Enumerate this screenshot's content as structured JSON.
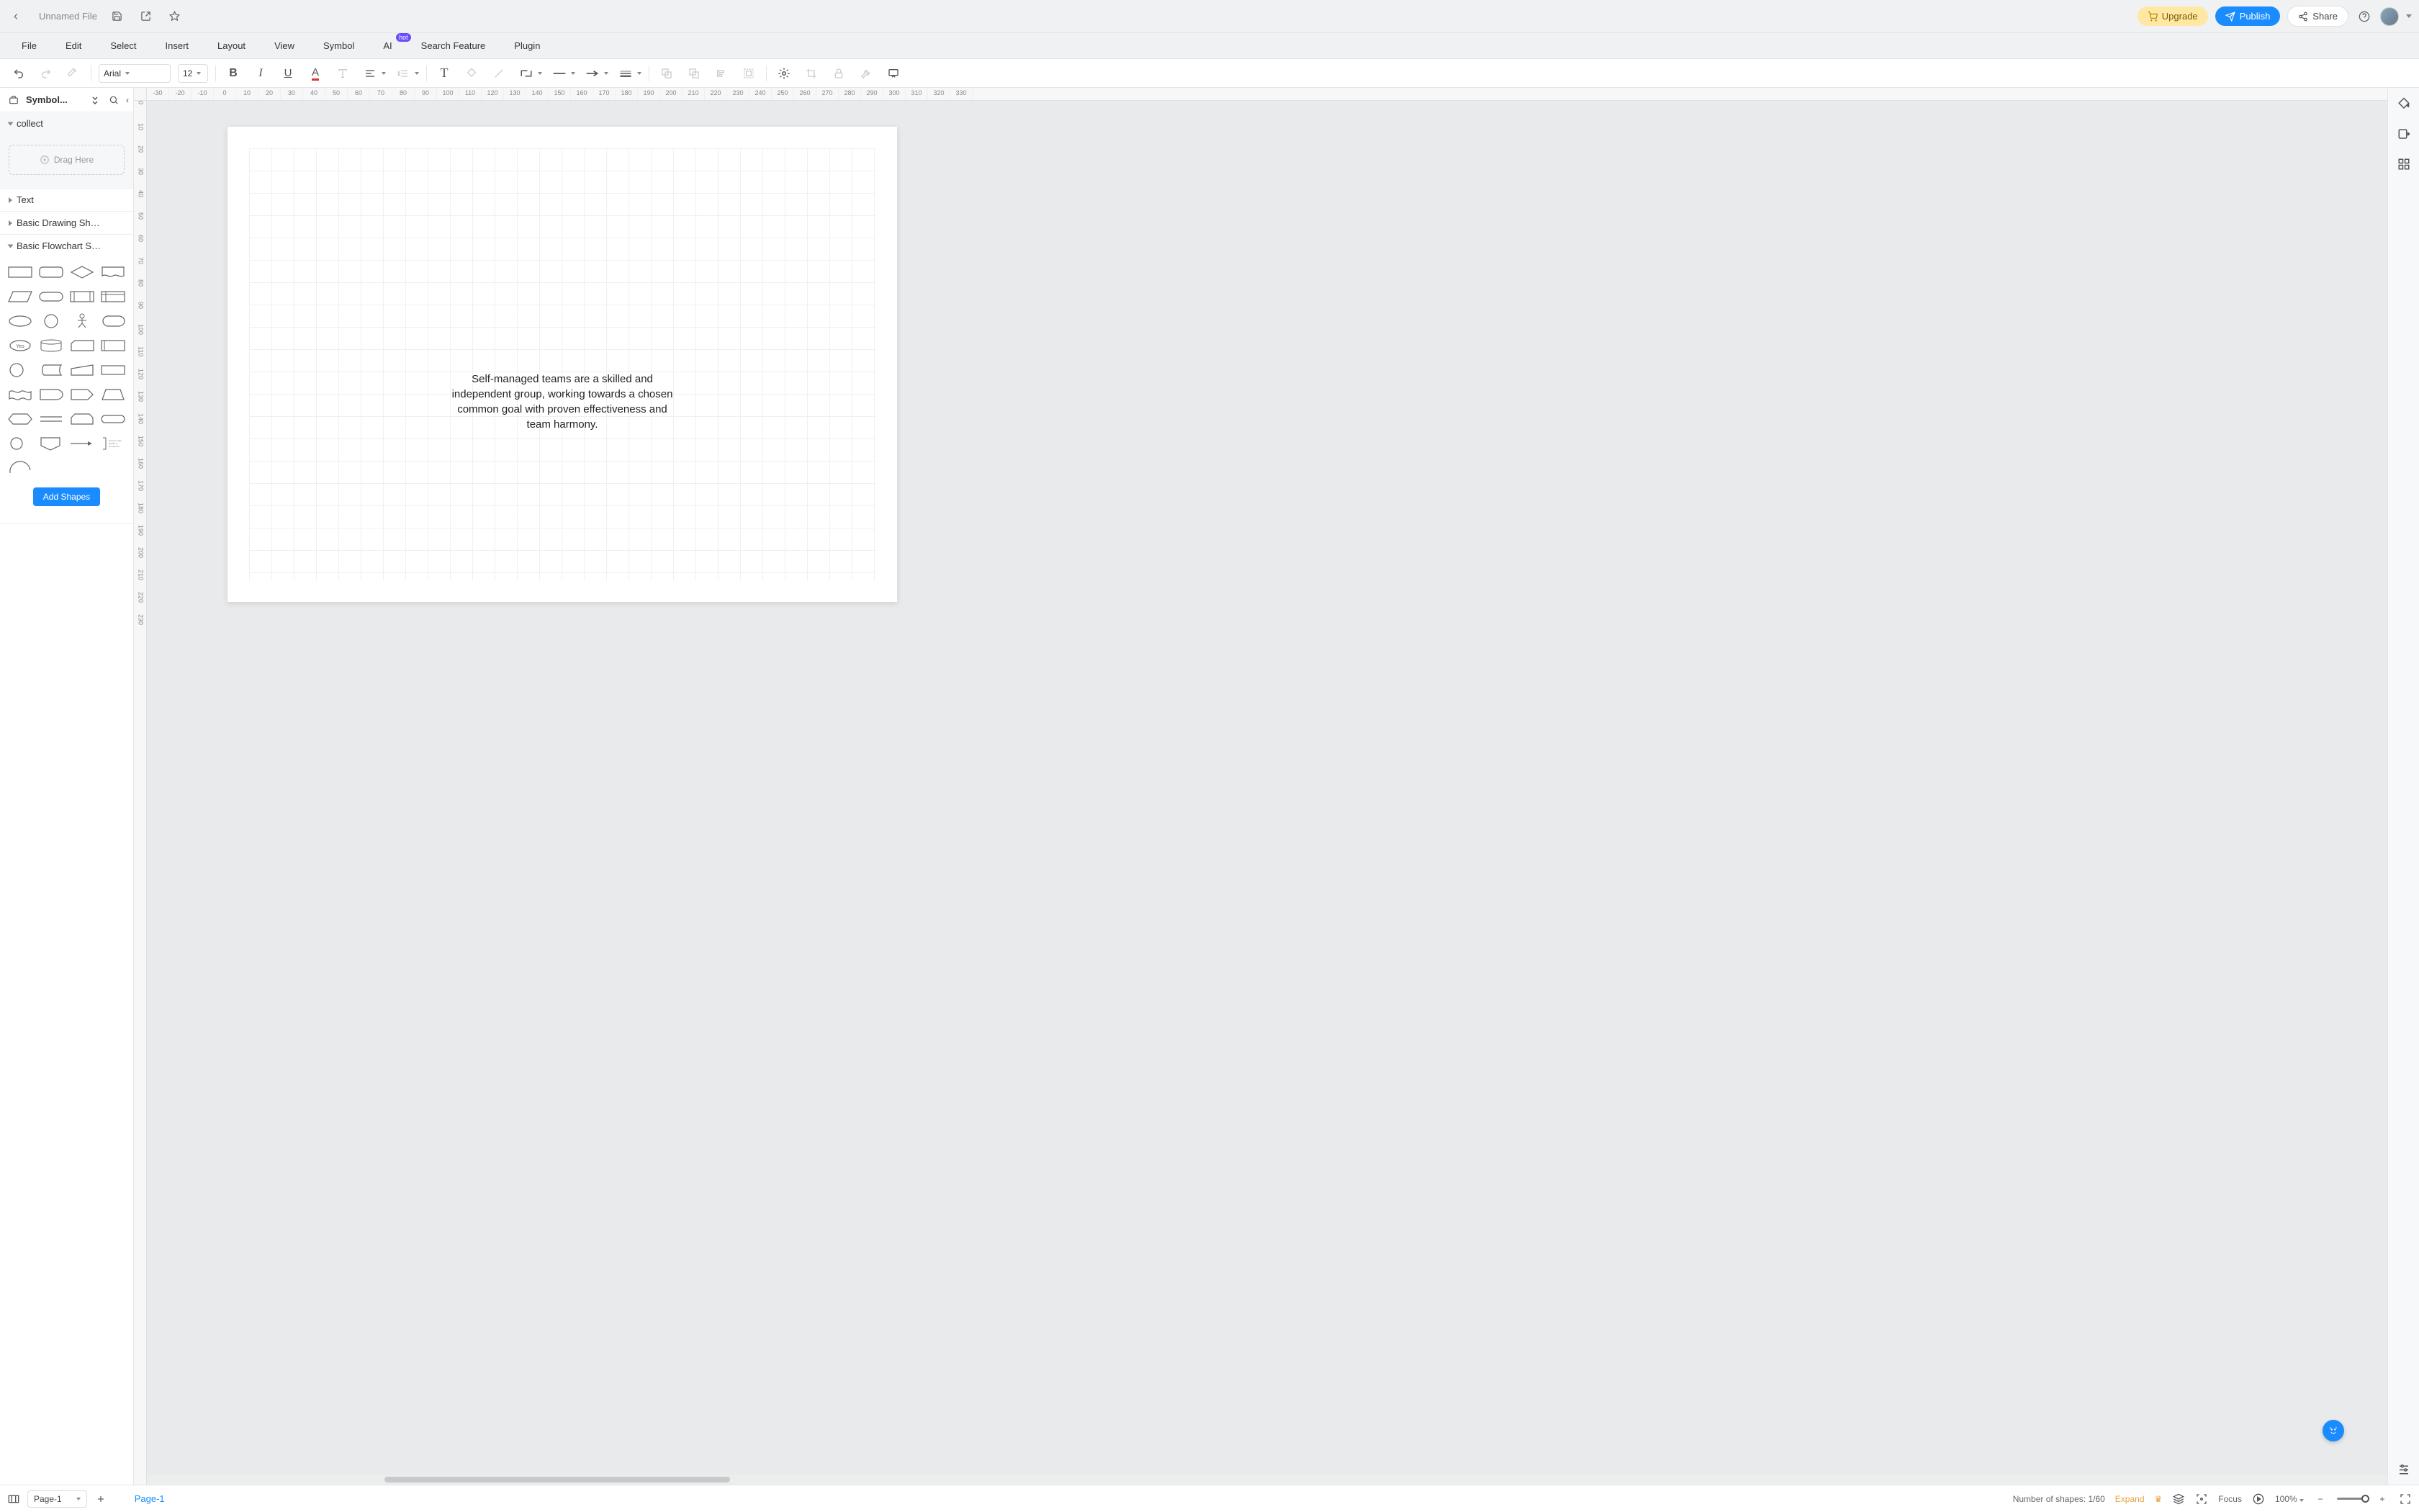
{
  "header": {
    "file_title": "Unnamed File",
    "upgrade_label": "Upgrade",
    "publish_label": "Publish",
    "share_label": "Share"
  },
  "menu": {
    "items": [
      "File",
      "Edit",
      "Select",
      "Insert",
      "Layout",
      "View",
      "Symbol",
      "AI",
      "Search Feature",
      "Plugin"
    ],
    "hot_badge": "hot"
  },
  "toolbar": {
    "font_family": "Arial",
    "font_size": "12"
  },
  "sidebar": {
    "title": "Symbol...",
    "collect_label": "collect",
    "drag_here": "Drag Here",
    "groups": {
      "text": "Text",
      "basic_drawing": "Basic Drawing Sh…",
      "basic_flowchart": "Basic Flowchart S…"
    },
    "add_shapes": "Add Shapes"
  },
  "ruler": {
    "h_ticks": [
      "-30",
      "-20",
      "-10",
      "0",
      "10",
      "20",
      "30",
      "40",
      "50",
      "60",
      "70",
      "80",
      "90",
      "100",
      "110",
      "120",
      "130",
      "140",
      "150",
      "160",
      "170",
      "180",
      "190",
      "200",
      "210",
      "220",
      "230",
      "240",
      "250",
      "260",
      "270",
      "280",
      "290",
      "300",
      "310",
      "320",
      "330"
    ],
    "v_ticks": [
      "0",
      "10",
      "20",
      "30",
      "40",
      "50",
      "60",
      "70",
      "80",
      "90",
      "100",
      "110",
      "120",
      "130",
      "140",
      "150",
      "160",
      "170",
      "180",
      "190",
      "200",
      "210",
      "220",
      "230"
    ]
  },
  "canvas": {
    "text": "Self-managed teams are a skilled and independent group, working towards a chosen common goal with proven effectiveness and team harmony."
  },
  "status": {
    "page_selector": "Page-1",
    "page_tab": "Page-1",
    "shapes_label": "Number of shapes: 1/60",
    "expand_label": "Expand",
    "focus_label": "Focus",
    "zoom_label": "100%"
  },
  "shapes": {
    "yes_label": "Yes"
  }
}
